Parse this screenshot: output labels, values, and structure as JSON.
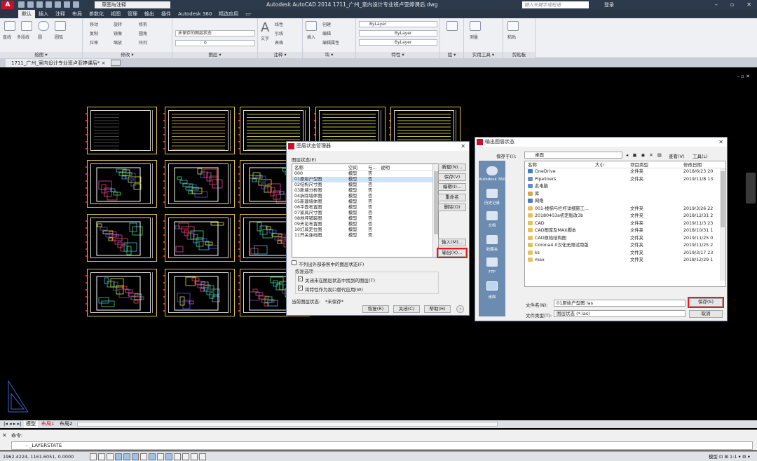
{
  "titlebar": {
    "logo": "A",
    "workspace": "草图与注释",
    "title": "Autodesk AutoCAD 2014    1711_广州_室内设计专业班卢亚婷课后.dwg",
    "search_placeholder": "键入关键字或短语",
    "login": "登录",
    "min": "–",
    "max": "▫",
    "close": "✕"
  },
  "ribbon_tabs": [
    "默认",
    "插入",
    "注释",
    "布局",
    "参数化",
    "视图",
    "管理",
    "输出",
    "插件",
    "Autodesk 360",
    "精选应用",
    "▭·"
  ],
  "ribbon": {
    "panels": {
      "draw": "绘图 ▾",
      "modify": "修改 ▾",
      "layers": "图层 ▾",
      "annotation": "注释 ▾",
      "block": "块 ▾",
      "properties": "特性 ▾",
      "group": "组 ▾",
      "utilities": "实用工具 ▾",
      "clipboard": "剪贴板"
    },
    "draw_items": [
      "直线",
      "多段线",
      "圆",
      "圆弧"
    ],
    "modify_items": [
      "移动",
      "旋转",
      "修剪",
      "复制",
      "镜像",
      "圆角",
      "拉伸",
      "缩放",
      "阵列"
    ],
    "layer_combo": "未保存的图层状态",
    "layer_current": "0",
    "annotation_items": [
      "文字",
      "线性",
      "引线",
      "表格"
    ],
    "block_items": [
      "插入",
      "创建",
      "编辑",
      "编辑属性"
    ],
    "bylayer_1": "ByLayer",
    "bylayer_2": "ByLayer",
    "bylayer_3": "ByLayer",
    "group_label": "组",
    "measure_label": "测量",
    "paste_label": "粘贴"
  },
  "document_tab": "1711_广州_室内设计专业班卢亚婷课后*",
  "viewport_controls": "–  ▫  ✕",
  "layout_tabs": [
    "模型",
    "布局1",
    "布局2"
  ],
  "command": {
    "history": "命令:",
    "input": "- _LAYERSTATE"
  },
  "status": {
    "coords": "1962.4224, 1161.6051, 0.0000",
    "right": "模型  ⊡  ⊞   1:1 ▾   ⚙   ▾"
  },
  "layer_state_manager": {
    "title": "图层状态管理器",
    "list_label": "图层状态(E)",
    "columns": [
      "名称",
      "空间",
      "与...",
      "说明"
    ],
    "rows": [
      {
        "name": "000",
        "space": "模型",
        "same": "否"
      },
      {
        "name": "01原始户型图",
        "space": "模型",
        "same": "否"
      },
      {
        "name": "02结构尺寸图",
        "space": "模型",
        "same": "否"
      },
      {
        "name": "03新墙分析图",
        "space": "模型",
        "same": "否"
      },
      {
        "name": "04拆除墙体图",
        "space": "模型",
        "same": "否"
      },
      {
        "name": "05新建墙体图",
        "space": "模型",
        "same": "否"
      },
      {
        "name": "06平面布置图",
        "space": "模型",
        "same": "否"
      },
      {
        "name": "07家具尺寸图",
        "space": "模型",
        "same": "否"
      },
      {
        "name": "08地坪铺装图",
        "space": "模型",
        "same": "否"
      },
      {
        "name": "09天花布置图",
        "space": "模型",
        "same": "否"
      },
      {
        "name": "10灯具定位图",
        "space": "模型",
        "same": "否"
      },
      {
        "name": "11开关连线图",
        "space": "模型",
        "same": "否"
      }
    ],
    "buttons": {
      "new": "新建(N)...",
      "save": "保存(V)",
      "edit": "编辑(I)...",
      "rename": "重命名",
      "delete": "删除(D)",
      "import": "输入(M)...",
      "export": "输出(X)...",
      "restore": "恢复(R)",
      "close": "关闭(C)",
      "help": "帮助(H)"
    },
    "chk_xref": "不列出外部参照中的图层状态(F)",
    "restore_options": "恢复选项",
    "chk_off": "关闭未在图层状态中找到的图层(T)",
    "chk_apply": "将特性作为视口替代应用(W)",
    "current_label": "当前图层状态:",
    "current_value": "*未保存*",
    "expand": "›"
  },
  "export_dialog": {
    "title": "输出图层状态",
    "save_in_label": "保存于(I):",
    "save_in_value": "桌面",
    "views_label": "查看(V)",
    "tools_label": "工具(L)",
    "places": [
      "Autodesk 360",
      "历史记录",
      "文档",
      "收藏夹",
      "FTP",
      "桌面"
    ],
    "columns": [
      "名称",
      "大小",
      "项目类型",
      "修改日期"
    ],
    "files": [
      {
        "name": "OneDrive",
        "size": "",
        "type": "文件夹",
        "date": "2018/6/23 20",
        "icon": "cloud"
      },
      {
        "name": "Pipeliners",
        "size": "",
        "type": "文件夹",
        "date": "2019/11/8 13",
        "icon": "user"
      },
      {
        "name": "此电脑",
        "size": "",
        "type": "",
        "date": "",
        "icon": "pc"
      },
      {
        "name": "库",
        "size": "",
        "type": "",
        "date": "",
        "icon": "lib"
      },
      {
        "name": "网络",
        "size": "",
        "type": "",
        "date": "",
        "icon": "net"
      },
      {
        "name": "001-楼梯与栏杆详细施工...",
        "size": "",
        "type": "文件夹",
        "date": "2019/3/26 22",
        "icon": "folder"
      },
      {
        "name": "20180403a初定版改3b",
        "size": "",
        "type": "文件夹",
        "date": "2018/12/31 2",
        "icon": "folder"
      },
      {
        "name": "CAD",
        "size": "",
        "type": "文件夹",
        "date": "2019/11/3 23",
        "icon": "folder"
      },
      {
        "name": "CAD图库及MAX脚本",
        "size": "",
        "type": "文件夹",
        "date": "2018/10/31 1",
        "icon": "folder"
      },
      {
        "name": "CAD原始结构图",
        "size": "",
        "type": "文件夹",
        "date": "2019/11/25 0",
        "icon": "folder"
      },
      {
        "name": "Corona4.0汉化无限试用版",
        "size": "",
        "type": "文件夹",
        "date": "2019/11/25 2",
        "icon": "folder"
      },
      {
        "name": "ks",
        "size": "",
        "type": "文件夹",
        "date": "2019/3/17 23",
        "icon": "folder"
      },
      {
        "name": "max",
        "size": "",
        "type": "文件夹",
        "date": "2018/12/29 1",
        "icon": "folder"
      }
    ],
    "filename_label": "文件名(N):",
    "filename_value": "01原始户型图 las",
    "filetype_label": "文件类型(T):",
    "filetype_value": "图层状态 (*.las)",
    "save_button": "保存(S)",
    "cancel_button": "取消"
  },
  "colors": {
    "title_bg": "#2d3a4c",
    "highlight": "#e02020",
    "sheet_border": "#e0c040",
    "places_bg": "#6c8bb1"
  }
}
